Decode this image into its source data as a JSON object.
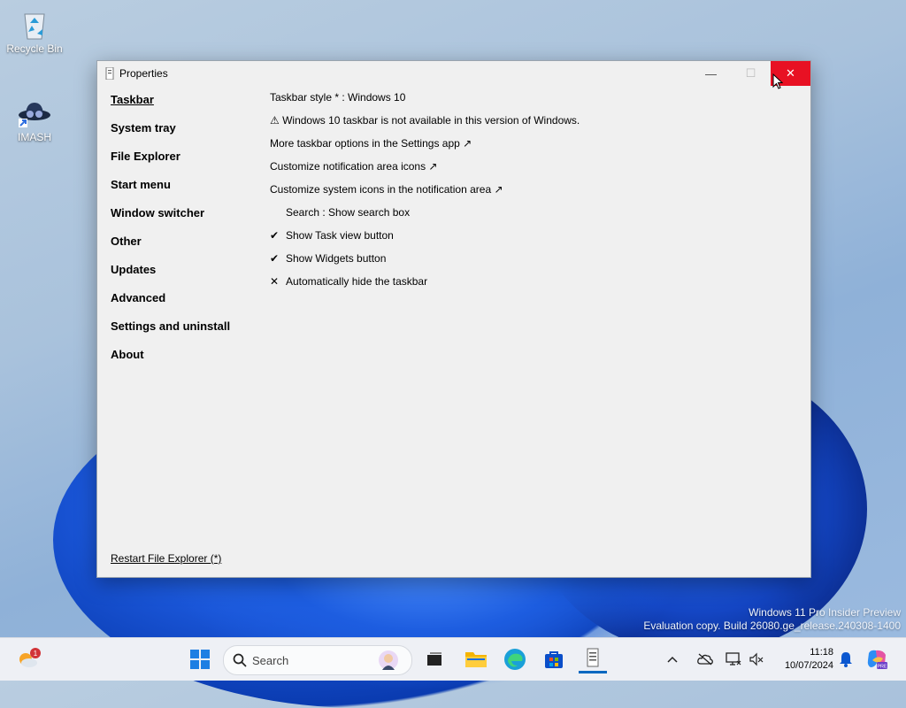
{
  "desktop": {
    "icons": [
      {
        "label": "Recycle Bin",
        "icon": "recycle-bin-icon"
      },
      {
        "label": "IMASH",
        "icon": "spy-hat-icon"
      }
    ],
    "watermark": {
      "line1": "Windows 11 Pro Insider Preview",
      "line2": "Evaluation copy. Build 26080.ge_release.240308-1400"
    }
  },
  "window": {
    "title": "Properties",
    "buttons": {
      "minimize": "—",
      "maximize": "☐",
      "close": "✕"
    },
    "sidebar": {
      "items": [
        {
          "label": "Taskbar",
          "active": true
        },
        {
          "label": "System tray"
        },
        {
          "label": "File Explorer"
        },
        {
          "label": "Start menu"
        },
        {
          "label": "Window switcher"
        },
        {
          "label": "Other"
        },
        {
          "label": "Updates"
        },
        {
          "label": "Advanced"
        },
        {
          "label": "Settings and uninstall"
        },
        {
          "label": "About"
        }
      ],
      "restart": "Restart File Explorer (*)"
    },
    "content": {
      "rows": [
        {
          "mark": "",
          "text": "Taskbar style * : Windows 10"
        },
        {
          "mark": "",
          "text": "⚠ Windows 10 taskbar is not available in this version of Windows."
        },
        {
          "mark": "",
          "text": "More taskbar options in the Settings app ↗"
        },
        {
          "mark": "",
          "text": "Customize notification area icons ↗"
        },
        {
          "mark": "",
          "text": "Customize system icons in the notification area ↗"
        },
        {
          "mark": " ",
          "text": "Search : Show search box"
        },
        {
          "mark": "✔",
          "text": "Show Task view button"
        },
        {
          "mark": "✔",
          "text": "Show Widgets button"
        },
        {
          "mark": "✕",
          "text": "Automatically hide the taskbar"
        }
      ]
    }
  },
  "taskbar": {
    "search_placeholder": "Search",
    "weather_badge": "1",
    "time": "11:18",
    "date": "10/07/2024",
    "apps": [
      "start-icon",
      "search-icon",
      "task-view-icon",
      "file-explorer-icon",
      "edge-icon",
      "store-icon",
      "properties-app-icon"
    ],
    "tray": [
      "chevron-up-icon",
      "cloud-off-icon",
      "network-icon",
      "volume-off-icon",
      "bell-icon",
      "copilot-icon"
    ]
  }
}
